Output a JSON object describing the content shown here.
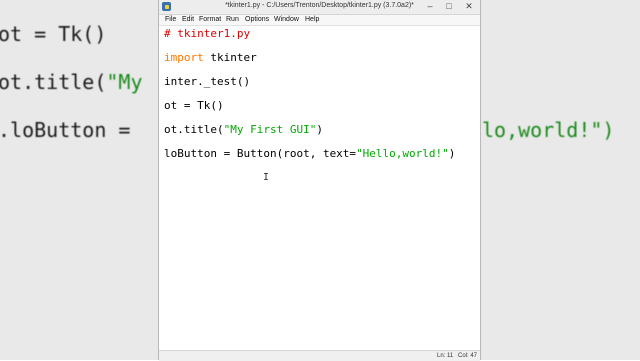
{
  "background_code": {
    "line1": "ot = Tk()",
    "line2a": "ot.title(",
    "line2b": "\"My",
    "line3a": ".loButton = ",
    "line3b": "lo,world!\")"
  },
  "window": {
    "title": "*tkinter1.py - C:/Users/Trenton/Desktop/tkinter1.py (3.7.0a2)*",
    "minimize": "–",
    "maximize": "□",
    "close": "✕"
  },
  "menu": [
    "File",
    "Edit",
    "Format",
    "Run",
    "Options",
    "Window",
    "Help"
  ],
  "code": {
    "line1": "# tkinter1.py",
    "line2_kw": "import",
    "line2_rest": " tkinter",
    "line3": "inter._test()",
    "line4": "ot = Tk()",
    "line5_a": "ot.title(",
    "line5_str": "\"My First GUI\"",
    "line5_b": ")",
    "line6_a": "loButton = Button(root, text=",
    "line6_str": "\"Hello,world!\"",
    "line6_b": ")"
  },
  "status": {
    "line": "Ln: 11",
    "col": "Col: 47"
  },
  "colors": {
    "comment": "#dd0000",
    "keyword": "#ff7700",
    "string": "#00aa00"
  }
}
